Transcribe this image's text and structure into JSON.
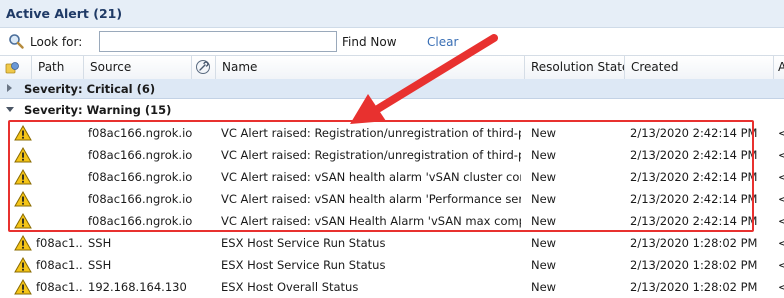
{
  "window": {
    "title": "Active Alert (21)"
  },
  "search": {
    "look_for_label": "Look for:",
    "value": "",
    "placeholder": "",
    "find_now_label": "Find Now",
    "clear_label": "Clear"
  },
  "columns": {
    "path": "Path",
    "source": "Source",
    "name": "Name",
    "resolution_state": "Resolution State",
    "created": "Created",
    "overflow": "A"
  },
  "groups": [
    {
      "label": "Severity: Critical (6)",
      "expanded": false
    },
    {
      "label": "Severity: Warning (15)",
      "expanded": true
    }
  ],
  "rows": [
    {
      "path": "",
      "source": "f08ac166.ngrok.io",
      "name": "VC Alert raised: Registration/unregistration of third-par...",
      "resolution_state": "New",
      "created": "2/13/2020 2:42:14 PM",
      "overflow": "<"
    },
    {
      "path": "",
      "source": "f08ac166.ngrok.io",
      "name": "VC Alert raised: Registration/unregistration of third-par...",
      "resolution_state": "New",
      "created": "2/13/2020 2:42:14 PM",
      "overflow": "<"
    },
    {
      "path": "",
      "source": "f08ac166.ngrok.io",
      "name": "VC Alert raised: vSAN health alarm 'vSAN cluster confi...",
      "resolution_state": "New",
      "created": "2/13/2020 2:42:14 PM",
      "overflow": "<"
    },
    {
      "path": "",
      "source": "f08ac166.ngrok.io",
      "name": "VC Alert raised: vSAN health alarm 'Performance servic...",
      "resolution_state": "New",
      "created": "2/13/2020 2:42:14 PM",
      "overflow": "<"
    },
    {
      "path": "",
      "source": "f08ac166.ngrok.io",
      "name": "VC Alert raised: vSAN Health Alarm 'vSAN max compo...",
      "resolution_state": "New",
      "created": "2/13/2020 2:42:14 PM",
      "overflow": "<"
    },
    {
      "path": "f08ac1...",
      "source": "SSH",
      "name": "ESX Host Service Run Status",
      "resolution_state": "New",
      "created": "2/13/2020 1:28:02 PM",
      "overflow": "<"
    },
    {
      "path": "f08ac1...",
      "source": "SSH",
      "name": "ESX Host Service Run Status",
      "resolution_state": "New",
      "created": "2/13/2020 1:28:02 PM",
      "overflow": "<"
    },
    {
      "path": "f08ac1...",
      "source": "192.168.164.130",
      "name": "ESX Host Overall Status",
      "resolution_state": "New",
      "created": "2/13/2020 1:28:02 PM",
      "overflow": "<"
    }
  ],
  "colors": {
    "annotation": "#e8312f",
    "title": "#1f3a66",
    "group_bg": "#dde8f5",
    "warning_icon": "#f5c518"
  },
  "icons": [
    "search-icon",
    "alert-state-icon",
    "tools-icon",
    "warning-icon"
  ]
}
